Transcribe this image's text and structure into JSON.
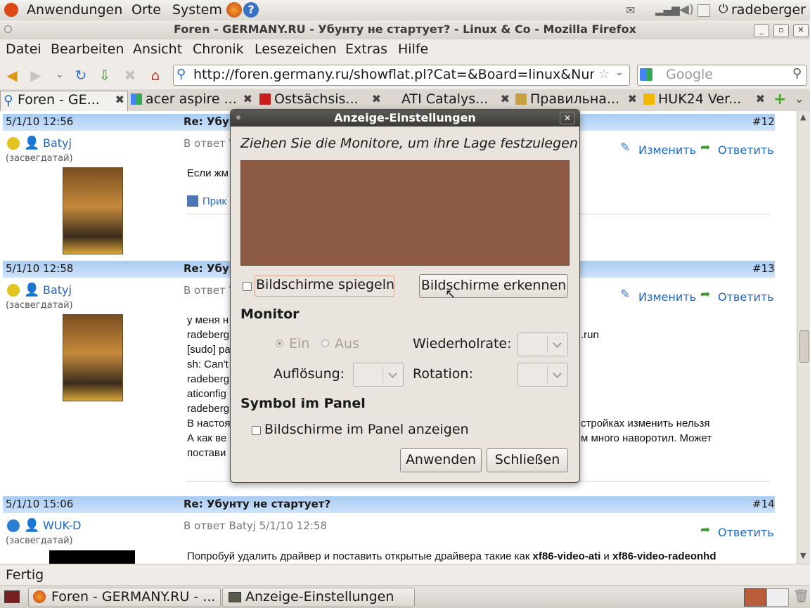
{
  "top_panel": {
    "menus": [
      "Anwendungen",
      "Orte",
      "System"
    ],
    "user": "radeberger"
  },
  "window": {
    "title": "Foren - GERMANY.RU - Убунту не стартует? - Linux & Co - Mozilla Firefox"
  },
  "menubar": [
    "Datei",
    "Bearbeiten",
    "Ansicht",
    "Chronik",
    "Lesezeichen",
    "Extras",
    "Hilfe"
  ],
  "navbar": {
    "url": "http://foren.germany.ru/showflat.pl?Cat=&Board=linux&Numb",
    "search_placeholder": "Google"
  },
  "tabs": [
    {
      "label": "Foren - GE..."
    },
    {
      "label": "acer aspire ..."
    },
    {
      "label": "Ostsächsis..."
    },
    {
      "label": "ATI Catalys..."
    },
    {
      "label": "Правильна..."
    },
    {
      "label": "HUK24 Ver..."
    }
  ],
  "posts": [
    {
      "date": "5/1/10 12:56",
      "subject": "Re: Убун",
      "number": "#12",
      "user": "Batyj",
      "rank": "(засвегдатай)",
      "reply_to": "В ответ V",
      "edit": "Изменить",
      "reply": "Ответить",
      "lines": [
        "Если жм"
      ],
      "attachment": "Прик"
    },
    {
      "date": "5/1/10 12:58",
      "subject": "Re: Убун",
      "number": "#13",
      "user": "Batyj",
      "rank": "(засвегдатай)",
      "reply_to": "В ответ V",
      "edit": "Изменить",
      "reply": "Ответить",
      "lines": [
        "у меня н",
        "radeberg",
        "[sudo] pa",
        "sh: Can't",
        "radeberg",
        "aticonfig",
        "radeberg",
        "В настоя",
        "А как ве",
        "постави"
      ],
      "right_fragments": [
        ".run",
        "стройках изменить нельзя",
        "м много наворотил. Может"
      ]
    },
    {
      "date": "5/1/10 15:06",
      "subject": "Re: Убунту не стартует?",
      "number": "#14",
      "user": "WUK-D",
      "rank": "(засвегдатай)",
      "reply_to": "В ответ Batyj 5/1/10 12:58",
      "reply": "Ответить",
      "line_pre": "Попробуй удалить драйвер и поставить открытые драйвера такие как ",
      "line_b1": "xf86-video-ati",
      "line_mid": " и ",
      "line_b2": "xf86-video-radeonhd"
    }
  ],
  "status": "Fertig",
  "taskbar": [
    "Foren - GERMANY.RU - ...",
    "Anzeige-Einstellungen"
  ],
  "dialog": {
    "title": "Anzeige-Einstellungen",
    "instruction": "Ziehen Sie die Monitore, um ihre Lage festzulegen",
    "mirror_label": "Bildschirme spiegeln",
    "detect_button": "Bildschirme erkennen",
    "monitor_heading": "Monitor",
    "on_label": "Ein",
    "off_label": "Aus",
    "refresh_label": "Wiederholrate:",
    "resolution_label": "Auflösung:",
    "rotation_label": "Rotation:",
    "panel_heading": "Symbol im Panel",
    "panel_checkbox_label": "Bildschirme im Panel anzeigen",
    "apply_button": "Anwenden",
    "close_button": "Schließen",
    "monitor_area_color": "#8c5a45"
  }
}
